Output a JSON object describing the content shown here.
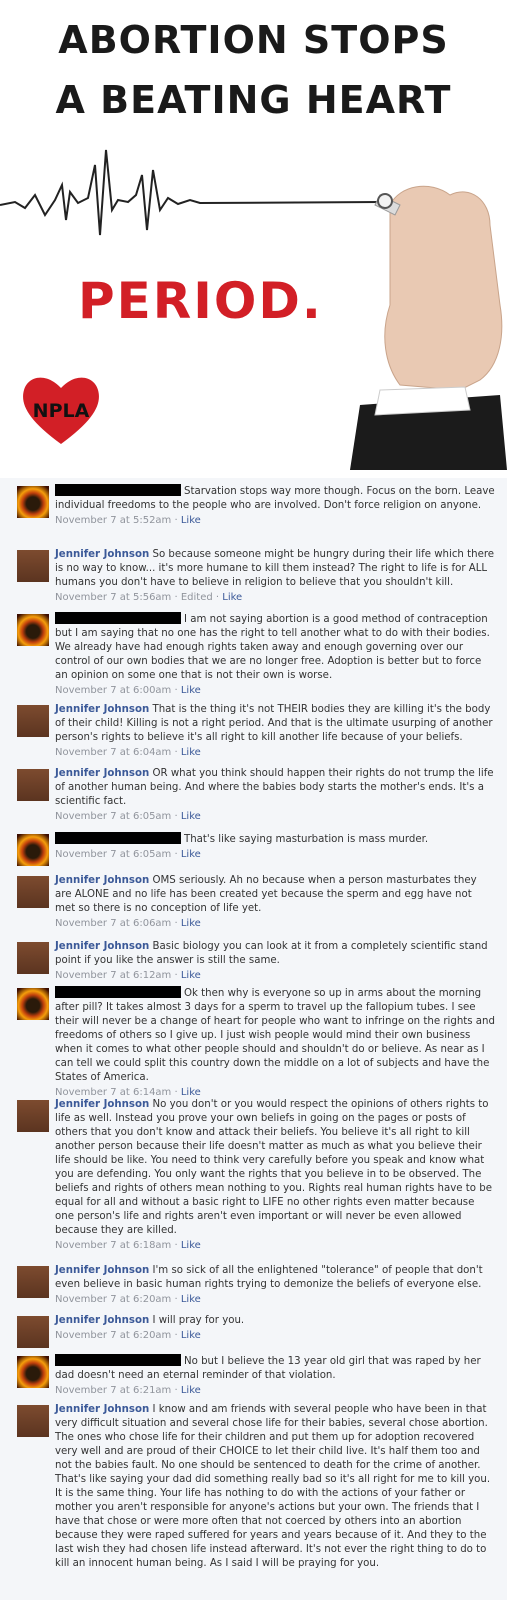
{
  "banner": {
    "headline_line1": "ABORTION STOPS",
    "headline_line2": "A BEATING HEART",
    "period": "PERIOD.",
    "logo_text": "NPLA"
  },
  "comments": [
    {
      "author": "",
      "redacted": true,
      "avatar": "fire",
      "text": "Starvation stops way more though. Focus on the born. Leave individual freedoms to the people who are involved. Don't force religion on anyone.",
      "time": "November 7 at 5:52am",
      "sep": " · ",
      "like": "Like",
      "edited": ""
    },
    {
      "author": "Jennifer Johnson",
      "redacted": false,
      "avatar": "jen",
      "text": "So because someone might be hungry during their life which there is no way to know... it's more humane to kill them instead? The right to life is for ALL humans you don't have to believe in religion to believe that you shouldn't kill.",
      "time": "November 7 at 5:56am",
      "sep": " · ",
      "like": "Like",
      "edited": "Edited · "
    },
    {
      "author": "",
      "redacted": true,
      "avatar": "fire",
      "text": "I am not saying abortion is a good method of contraception but I am saying that no one has the right to tell another what to do with their bodies. We already have had enough rights taken away and enough governing over our control of our own bodies that we are no longer free. Adoption is better but to force an opinion on some one that is not their own is worse.",
      "time": "November 7 at 6:00am",
      "sep": " · ",
      "like": "Like",
      "edited": ""
    },
    {
      "author": "Jennifer Johnson",
      "redacted": false,
      "avatar": "jen",
      "text": "That is the thing it's not THEIR bodies they are killing it's the body of their child! Killing is not a right period. And that is the ultimate usurping of another person's rights to believe it's all right to kill another life because of your beliefs.",
      "time": "November 7 at 6:04am",
      "sep": " · ",
      "like": "Like",
      "edited": ""
    },
    {
      "author": "Jennifer Johnson",
      "redacted": false,
      "avatar": "jen",
      "text": "OR what you think should happen their rights do not trump the life of another human being. And where the babies body starts the mother's ends. It's a scientific fact.",
      "time": "November 7 at 6:05am",
      "sep": " · ",
      "like": "Like",
      "edited": ""
    },
    {
      "author": "",
      "redacted": true,
      "avatar": "fire",
      "text": "That's like saying masturbation is mass murder.",
      "time": "November 7 at 6:05am",
      "sep": " · ",
      "like": "Like",
      "edited": ""
    },
    {
      "author": "Jennifer Johnson",
      "redacted": false,
      "avatar": "jen",
      "text": "OMS seriously. Ah no because when a person masturbates they are ALONE and no life has been created yet because the sperm and egg have not met so there is no conception of life yet.",
      "time": "November 7 at 6:06am",
      "sep": " · ",
      "like": "Like",
      "edited": ""
    },
    {
      "author": "Jennifer Johnson",
      "redacted": false,
      "avatar": "jen",
      "text": "Basic biology you can look at it from a completely scientific stand point if you like the answer is still the same.",
      "time": "November 7 at 6:12am",
      "sep": " · ",
      "like": "Like",
      "edited": ""
    },
    {
      "author": "",
      "redacted": true,
      "avatar": "fire",
      "text": "Ok then why is everyone so up in arms about the morning after pill? It takes almost 3 days for a sperm to travel up the fallopium tubes. I see their will never be a change of heart for people who want to infringe on the rights and freedoms of others so I give up. I just wish people would mind their own business when it comes to what other people should and shouldn't do or believe. As near as I can tell we could split this country down the middle on a lot of subjects and have the States of America.",
      "time": "November 7 at 6:14am",
      "sep": " · ",
      "like": "Like",
      "edited": ""
    },
    {
      "author": "Jennifer Johnson",
      "redacted": false,
      "avatar": "jen",
      "text": "No you don't or you would respect the opinions of others rights to life as well. Instead you prove your own beliefs in going on the pages or posts of others that you don't know and attack their beliefs. You believe it's all right to kill another person because their life doesn't matter as much as what you believe their life should be like. You need to think very carefully before you speak and know what you are defending. You only want the rights that you believe in to be observed. The beliefs and rights of others mean nothing to you. Rights real human rights have to be equal for all and without a basic right to LIFE no other rights even matter because one person's life and rights aren't even important or will never be even allowed because they are killed.",
      "time": "November 7 at 6:18am",
      "sep": " · ",
      "like": "Like",
      "edited": ""
    },
    {
      "author": "Jennifer Johnson",
      "redacted": false,
      "avatar": "jen",
      "text": "I'm so sick of all the enlightened \"tolerance\" of people that don't even believe in basic human rights trying to demonize the beliefs of everyone else.",
      "time": "November 7 at 6:20am",
      "sep": " · ",
      "like": "Like",
      "edited": ""
    },
    {
      "author": "Jennifer Johnson",
      "redacted": false,
      "avatar": "jen",
      "text": "I will pray for you.",
      "time": "November 7 at 6:20am",
      "sep": " · ",
      "like": "Like",
      "edited": ""
    },
    {
      "author": "",
      "redacted": true,
      "avatar": "fire",
      "text": "No but I believe the 13 year old girl that was raped by her dad doesn't need an eternal reminder of that violation.",
      "time": "November 7 at 6:21am",
      "sep": " · ",
      "like": "Like",
      "edited": ""
    },
    {
      "author": "Jennifer Johnson",
      "redacted": false,
      "avatar": "jen",
      "text": "I know and am friends with several people who have been in that very difficult situation and several chose life for their babies, several chose abortion. The ones who chose life for their children and put them up for adoption recovered very well and are proud of their CHOICE to let their child live. It's half them too and not the babies fault. No one should be sentenced to death for the crime of another. That's like saying your dad did something really bad so it's all right for me to kill you. It is the same thing. Your life has nothing to do with the actions of your father or mother you aren't responsible for anyone's actions but your own. The friends that I have that chose or were more often that not coerced by others into an abortion because they were raped suffered for years and years because of it. And they to the last wish they had chosen life instead afterward. It's not ever the right thing to do to kill an innocent human being. As I said I will be praying for you.",
      "time": "",
      "sep": "",
      "like": "",
      "edited": ""
    }
  ]
}
